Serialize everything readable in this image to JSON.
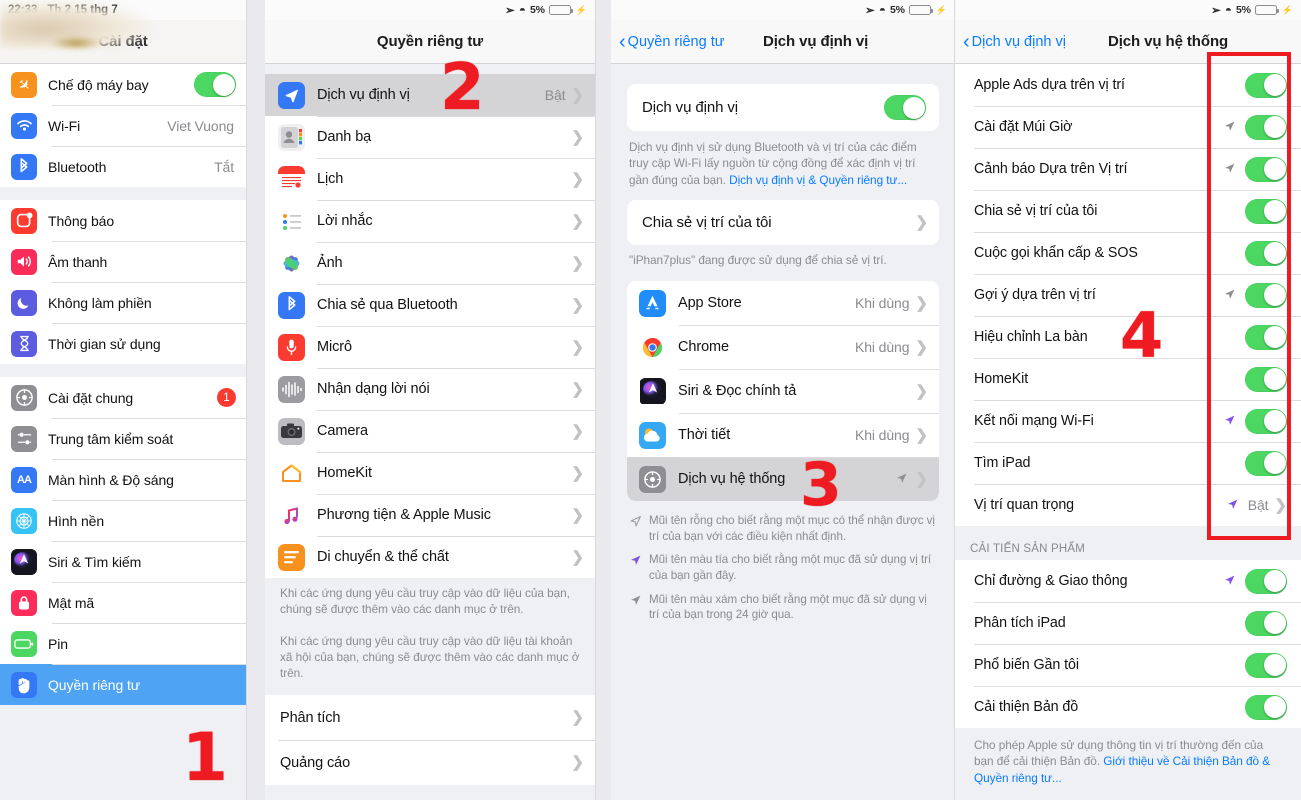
{
  "status_bar": {
    "time": "22:33",
    "date": "Th 2 15 thg 7",
    "airplane_icon": "airplane-icon",
    "wifi_icon": "wifi-icon",
    "battery_percent": "5%",
    "charging_icon": "lightning-bolt-icon"
  },
  "panel1": {
    "title": "Cài đặt",
    "sections": [
      {
        "items": [
          {
            "label": "Chế độ máy bay",
            "icon": "airplane-icon",
            "icon_color": "#f7921e",
            "control": "toggle",
            "toggle_on": true
          },
          {
            "label": "Wi-Fi",
            "icon": "wifi-icon",
            "icon_color": "#3478f6",
            "value": "Viet Vuong"
          },
          {
            "label": "Bluetooth",
            "icon": "bluetooth-icon",
            "icon_color": "#3478f6",
            "value": "Tắt"
          }
        ]
      },
      {
        "items": [
          {
            "label": "Thông báo",
            "icon": "notification-icon",
            "icon_color": "#fc3b30"
          },
          {
            "label": "Âm thanh",
            "icon": "speaker-icon",
            "icon_color": "#fb2b5a"
          },
          {
            "label": "Không làm phiền",
            "icon": "moon-icon",
            "icon_color": "#5c5ce0"
          },
          {
            "label": "Thời gian sử dụng",
            "icon": "hourglass-icon",
            "icon_color": "#5c5ce0"
          }
        ]
      },
      {
        "items": [
          {
            "label": "Cài đặt chung",
            "icon": "gear-icon",
            "icon_color": "#8e8e93",
            "badge": "1"
          },
          {
            "label": "Trung tâm kiểm soát",
            "icon": "control-center-icon",
            "icon_color": "#8e8e93"
          },
          {
            "label": "Màn hình & Độ sáng",
            "icon": "display-brightness-icon",
            "icon_color": "#3478f6"
          },
          {
            "label": "Hình nền",
            "icon": "wallpaper-icon",
            "icon_color": "#35c3f3"
          },
          {
            "label": "Siri & Tìm kiếm",
            "icon": "siri-icon",
            "icon_color": "#2b2b38"
          },
          {
            "label": "Mật mã",
            "icon": "lock-icon",
            "icon_color": "#fb2b5a"
          },
          {
            "label": "Pin",
            "icon": "battery-icon",
            "icon_color": "#4cd662"
          },
          {
            "label": "Quyền riêng tư",
            "icon": "hand-privacy-icon",
            "icon_color": "#3478f6",
            "selected": true
          }
        ]
      }
    ]
  },
  "panel2": {
    "title": "Quyền riêng tư",
    "items": [
      {
        "label": "Dịch vụ định vị",
        "icon": "location-arrow-icon",
        "icon_color": "#3478f6",
        "value": "Bật",
        "highlighted": true
      },
      {
        "label": "Danh bạ",
        "icon": "contacts-icon",
        "icon_color": "#c8c8cc"
      },
      {
        "label": "Lịch",
        "icon": "calendar-icon",
        "icon_color": "#ffffff"
      },
      {
        "label": "Lời nhắc",
        "icon": "reminders-icon",
        "icon_color": "#ffffff"
      },
      {
        "label": "Ảnh",
        "icon": "photos-icon",
        "icon_color": "#ffffff"
      },
      {
        "label": "Chia sẻ qua Bluetooth",
        "icon": "bluetooth-icon",
        "icon_color": "#3478f6"
      },
      {
        "label": "Micrô",
        "icon": "microphone-icon",
        "icon_color": "#fc3b30"
      },
      {
        "label": "Nhận dạng lời nói",
        "icon": "speech-waveform-icon",
        "icon_color": "#8e8e93"
      },
      {
        "label": "Camera",
        "icon": "camera-icon",
        "icon_color": "#a8a8ad"
      },
      {
        "label": "HomeKit",
        "icon": "home-icon",
        "icon_color": "#ffffff"
      },
      {
        "label": "Phương tiện & Apple Music",
        "icon": "music-note-icon",
        "icon_color": "#ffffff"
      },
      {
        "label": "Di chuyển & thể chất",
        "icon": "motion-fitness-icon",
        "icon_color": "#f7921e"
      }
    ],
    "footnote1": "Khi các ứng dụng yêu cầu truy cập vào dữ liệu của bạn, chúng sẽ được thêm vào các danh mục ở trên.",
    "footnote2": "Khi các ứng dụng yêu cầu truy cập vào dữ liệu tài khoản xã hội của bạn, chúng sẽ được thêm vào các danh mục ở trên.",
    "bottom_items": [
      {
        "label": "Phân tích"
      },
      {
        "label": "Quảng cáo"
      }
    ]
  },
  "panel3": {
    "back_label": "Quyền riêng tư",
    "title": "Dịch vụ định vị",
    "master_toggle_label": "Dịch vụ định vị",
    "master_toggle_on": true,
    "description": "Dịch vụ định vị sử dụng Bluetooth và vị trí của các điểm truy cập Wi-Fi lấy nguồn từ cộng đồng để xác định vị trí gần đúng của bạn. ",
    "description_link": "Dịch vụ định vị & Quyền riêng tư...",
    "share_location_label": "Chia sẻ vị trí của tôi",
    "share_location_note": "\"iPhan7plus\" đang được sử dụng để chia sẻ vị trí.",
    "apps": [
      {
        "label": "App Store",
        "icon": "app-store-icon",
        "value": "Khi dùng"
      },
      {
        "label": "Chrome",
        "icon": "chrome-icon",
        "value": "Khi dùng"
      },
      {
        "label": "Siri & Đọc chính tả",
        "icon": "siri-icon",
        "value": ""
      },
      {
        "label": "Thời tiết",
        "icon": "weather-icon",
        "value": "Khi dùng"
      },
      {
        "label": "Dịch vụ hệ thống",
        "icon": "gear-icon",
        "value": "",
        "arrow": "gray",
        "highlighted": true
      }
    ],
    "legend": [
      {
        "arrow": "hollow",
        "text": "Mũi tên rỗng cho biết rằng một mục có thể nhận được vị trí của bạn với các điều kiện nhất định."
      },
      {
        "arrow": "purple",
        "text": "Mũi tên màu tía cho biết rằng một mục đã sử dụng vị trí của bạn gần đây."
      },
      {
        "arrow": "gray",
        "text": "Mũi tên màu xám cho biết rằng một mục đã sử dụng vị trí của bạn trong 24 giờ qua."
      }
    ]
  },
  "panel4": {
    "back_label": "Dịch vụ định vị",
    "title": "Dịch vụ hệ thống",
    "system_services": [
      {
        "label": "Apple Ads dựa trên vị trí",
        "arrow": "",
        "toggle_on": true
      },
      {
        "label": "Cài đặt Múi Giờ",
        "arrow": "gray",
        "toggle_on": true
      },
      {
        "label": "Cảnh báo Dựa trên Vị trí",
        "arrow": "gray",
        "toggle_on": true
      },
      {
        "label": "Chia sẻ vị trí của tôi",
        "arrow": "",
        "toggle_on": true
      },
      {
        "label": "Cuộc gọi khẩn cấp & SOS",
        "arrow": "",
        "toggle_on": true
      },
      {
        "label": "Gợi ý dựa trên vị trí",
        "arrow": "gray",
        "toggle_on": true
      },
      {
        "label": "Hiệu chỉnh La bàn",
        "arrow": "",
        "toggle_on": true
      },
      {
        "label": "HomeKit",
        "arrow": "",
        "toggle_on": true
      },
      {
        "label": "Kết nối mạng Wi-Fi",
        "arrow": "purple",
        "toggle_on": true
      },
      {
        "label": "Tìm iPad",
        "arrow": "",
        "toggle_on": true
      },
      {
        "label": "Vị trí quan trọng",
        "arrow": "purple",
        "value": "Bật",
        "chevron": true
      }
    ],
    "improvement_header": "CẢI TIẾN SẢN PHẨM",
    "improvement_items": [
      {
        "label": "Chỉ đường & Giao thông",
        "arrow": "purple",
        "toggle_on": true
      },
      {
        "label": "Phân tích iPad",
        "arrow": "",
        "toggle_on": true
      },
      {
        "label": "Phổ biến Gần tôi",
        "arrow": "",
        "toggle_on": true
      },
      {
        "label": "Cải thiện Bản đồ",
        "arrow": "",
        "toggle_on": true
      }
    ],
    "improvement_footnote": "Cho phép Apple sử dụng thông tin vị trí thường đến của bạn để cải thiện Bản đồ. ",
    "improvement_footnote_link": "Giới thiệu về Cải thiện Bản đồ & Quyền riêng tư..."
  },
  "annotations": {
    "markers": [
      {
        "number": "1",
        "panel": "panel1"
      },
      {
        "number": "2",
        "panel": "panel2"
      },
      {
        "number": "3",
        "panel": "panel3"
      },
      {
        "number": "4",
        "panel": "panel4"
      }
    ],
    "highlight_color": "#ee1c22"
  }
}
